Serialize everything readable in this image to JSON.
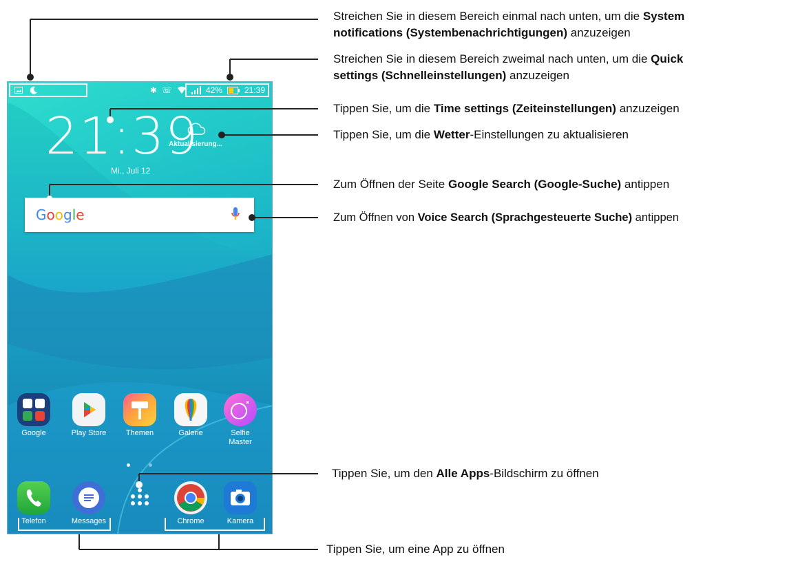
{
  "status_bar": {
    "battery_percent": "42%",
    "time": "21:39"
  },
  "clock": {
    "time": "21:39",
    "date": "Mi., Juli 12"
  },
  "weather": {
    "label": "Aktualisierung..."
  },
  "search": {
    "logo": "Google",
    "icon": "microphone-icon"
  },
  "apps_row1": [
    {
      "label": "Google",
      "icon": "google-folder-icon"
    },
    {
      "label": "Play Store",
      "icon": "play-store-icon"
    },
    {
      "label": "Themen",
      "icon": "themes-icon"
    },
    {
      "label": "Galerie",
      "icon": "gallery-icon"
    },
    {
      "label": "Selfie Master",
      "icon": "selfie-master-icon"
    }
  ],
  "dock": [
    {
      "label": "Telefon",
      "icon": "phone-icon"
    },
    {
      "label": "Messages",
      "icon": "messages-icon"
    },
    {
      "label": "",
      "icon": "all-apps-icon"
    },
    {
      "label": "Chrome",
      "icon": "chrome-icon"
    },
    {
      "label": "Kamera",
      "icon": "camera-icon"
    }
  ],
  "annotations": {
    "notifications": {
      "pre": "Streichen Sie in diesem Bereich einmal nach unten, um die ",
      "bold": "System",
      "bold2": "notifications (Systembenachrichtigungen)",
      "post": " anzuzeigen"
    },
    "quick_settings": {
      "pre": "Streichen Sie in diesem Bereich zweimal nach unten, um die ",
      "bold": "Quick",
      "bold2": "settings (Schnelleinstellungen)",
      "post": " anzuzeigen"
    },
    "time_settings": {
      "pre": "Tippen Sie, um die ",
      "bold": "Time settings (Zeiteinstellungen)",
      "post": " anzuzeigen"
    },
    "weather": {
      "pre": "Tippen Sie, um die ",
      "bold": "Wetter",
      "post": "-Einstellungen zu aktualisieren"
    },
    "google_search": {
      "pre": "Zum Öffnen der Seite ",
      "bold": "Google Search (Google-Suche)",
      "post": " antippen"
    },
    "voice_search": {
      "pre": "Zum Öffnen von ",
      "bold": "Voice Search (Sprachgesteuerte Suche)",
      "post": " antippen"
    },
    "all_apps": {
      "pre": "Tippen Sie, um den ",
      "bold": "Alle Apps",
      "post": "-Bildschirm zu öffnen"
    },
    "open_app": {
      "text": "Tippen Sie, um eine App zu öffnen"
    }
  }
}
